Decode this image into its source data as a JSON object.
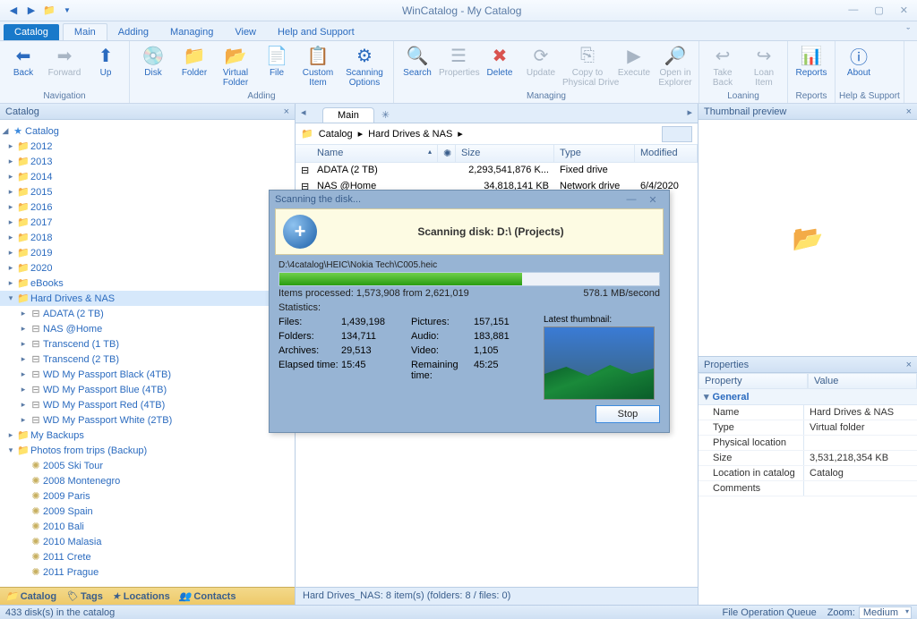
{
  "window": {
    "title": "WinCatalog - My Catalog"
  },
  "tabs": {
    "catalog": "Catalog",
    "main": "Main",
    "adding": "Adding",
    "managing": "Managing",
    "view": "View",
    "help": "Help and Support"
  },
  "ribbon": {
    "nav": {
      "back": "Back",
      "forward": "Forward",
      "up": "Up",
      "group": "Navigation"
    },
    "adding": {
      "disk": "Disk",
      "folder": "Folder",
      "vfolder": "Virtual\nFolder",
      "file": "File",
      "custom": "Custom\nItem",
      "scanopt": "Scanning\nOptions",
      "group": "Adding"
    },
    "managing": {
      "search": "Search",
      "props": "Properties",
      "delete": "Delete",
      "update": "Update",
      "copy": "Copy to\nPhysical Drive",
      "exec": "Execute",
      "open": "Open in\nExplorer",
      "group": "Managing"
    },
    "loaning": {
      "take": "Take\nBack",
      "loan": "Loan\nItem",
      "group": "Loaning"
    },
    "reports": {
      "reports": "Reports",
      "group": "Reports"
    },
    "helpgrp": {
      "about": "About",
      "group": "Help & Support"
    }
  },
  "leftPanel": {
    "title": "Catalog"
  },
  "tree": {
    "root": "Catalog",
    "years": [
      "2012",
      "2013",
      "2014",
      "2015",
      "2016",
      "2017",
      "2018",
      "2019",
      "2020"
    ],
    "ebooks": "eBooks",
    "hdd": {
      "label": "Hard Drives & NAS",
      "children": [
        "ADATA (2 TB)",
        "NAS @Home",
        "Transcend (1 TB)",
        "Transcend (2 TB)",
        "WD My Passport Black (4TB)",
        "WD My Passport Blue (4TB)",
        "WD My Passport Red (4TB)",
        "WD My Passport White (2TB)"
      ]
    },
    "backups": "My Backups",
    "photos": {
      "label": "Photos from trips (Backup)",
      "children": [
        "2005 Ski Tour",
        "2008 Montenegro",
        "2009 Paris",
        "2009 Spain",
        "2010 Bali",
        "2010 Malasia",
        "2011 Crete",
        "2011 Prague"
      ]
    }
  },
  "bottomTabs": {
    "catalog": "Catalog",
    "tags": "Tags",
    "locations": "Locations",
    "contacts": "Contacts"
  },
  "center": {
    "tab": "Main",
    "crumb1": "Catalog",
    "crumb2": "Hard Drives & NAS",
    "cols": {
      "name": "Name",
      "size": "Size",
      "type": "Type",
      "modified": "Modified"
    },
    "rows": [
      {
        "name": "ADATA (2 TB)",
        "size": "2,293,541,876 K...",
        "type": "Fixed drive",
        "mod": ""
      },
      {
        "name": "NAS @Home",
        "size": "34,818,141 KB",
        "type": "Network drive",
        "mod": "6/4/2020"
      }
    ],
    "status": "Hard Drives_NAS: 8 item(s) (folders: 8 / files: 0)"
  },
  "rightThumb": {
    "title": "Thumbnail preview"
  },
  "props": {
    "title": "Properties",
    "colProp": "Property",
    "colVal": "Value",
    "group": "General",
    "rows": [
      {
        "k": "Name",
        "v": "Hard Drives & NAS"
      },
      {
        "k": "Type",
        "v": "Virtual folder"
      },
      {
        "k": "Physical location",
        "v": ""
      },
      {
        "k": "Size",
        "v": "3,531,218,354 KB"
      },
      {
        "k": "Location in catalog",
        "v": "Catalog"
      },
      {
        "k": "Comments",
        "v": ""
      }
    ]
  },
  "status": {
    "left": "433 disk(s) in the catalog",
    "queue": "File Operation Queue",
    "zoomLbl": "Zoom:",
    "zoomVal": "Medium"
  },
  "dialog": {
    "title": "Scanning the disk...",
    "banner": "Scanning disk: D:\\ (Projects)",
    "path": "D:\\4catalog\\HEIC\\Nokia Tech\\C005.heic",
    "itemsLine": "Items processed: 1,573,908 from 2,621,019",
    "speed": "578.1 MB/second",
    "statsLbl": "Statistics:",
    "left": [
      {
        "k": "Files:",
        "v": "1,439,198"
      },
      {
        "k": "Folders:",
        "v": "134,711"
      },
      {
        "k": "Archives:",
        "v": "29,513"
      },
      {
        "k": "Elapsed time:",
        "v": "15:45"
      }
    ],
    "right": [
      {
        "k": "Pictures:",
        "v": "157,151"
      },
      {
        "k": "Audio:",
        "v": "183,881"
      },
      {
        "k": "Video:",
        "v": "1,105"
      },
      {
        "k": "Remaining time:",
        "v": "45:25"
      }
    ],
    "latest": "Latest thumbnail:",
    "stop": "Stop"
  }
}
